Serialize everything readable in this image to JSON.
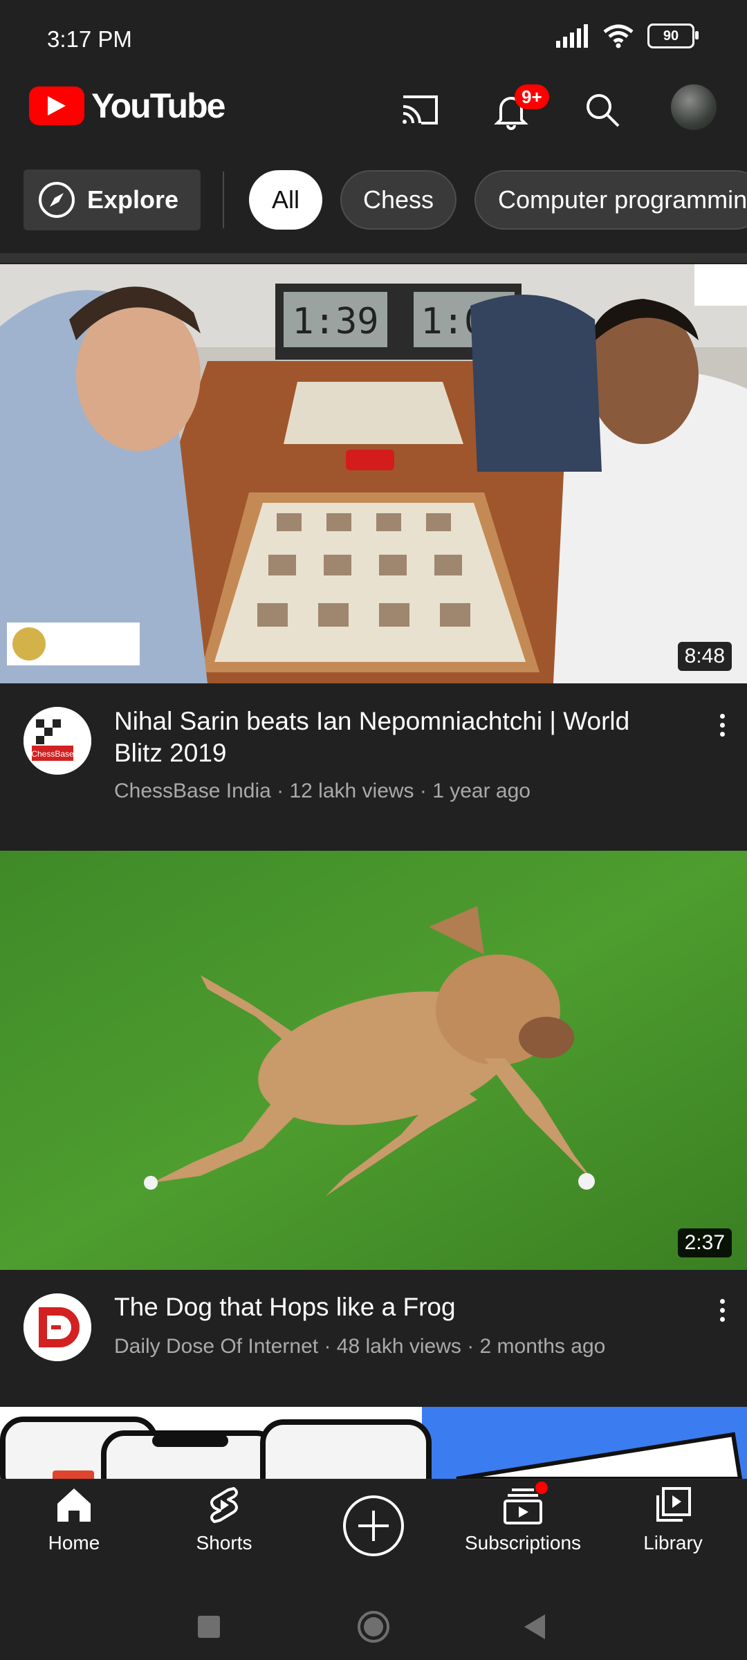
{
  "status_bar": {
    "time": "3:17 PM",
    "battery": "90"
  },
  "app_bar": {
    "logo_text": "YouTube",
    "notification_badge": "9+"
  },
  "chips": {
    "explore_label": "Explore",
    "items": [
      "All",
      "Chess",
      "Computer programming"
    ]
  },
  "videos": [
    {
      "title": "Nihal Sarin beats Ian Nepomniachtchi | World Blitz 2019",
      "meta": "ChessBase India · 12 lakh views · 1 year ago",
      "duration": "8:48",
      "channel_avatar_text": "ChessBase"
    },
    {
      "title": "The Dog that Hops like a Frog",
      "meta": "Daily Dose Of Internet · 48 lakh views · 2 months ago",
      "duration": "2:37"
    }
  ],
  "bottom_nav": {
    "home": "Home",
    "shorts": "Shorts",
    "subscriptions": "Subscriptions",
    "library": "Library"
  },
  "colors": {
    "background": "#212121",
    "brand_red": "#ff0000",
    "chip_bg": "#3a3a3a",
    "secondary_text": "#aaaaaa"
  }
}
